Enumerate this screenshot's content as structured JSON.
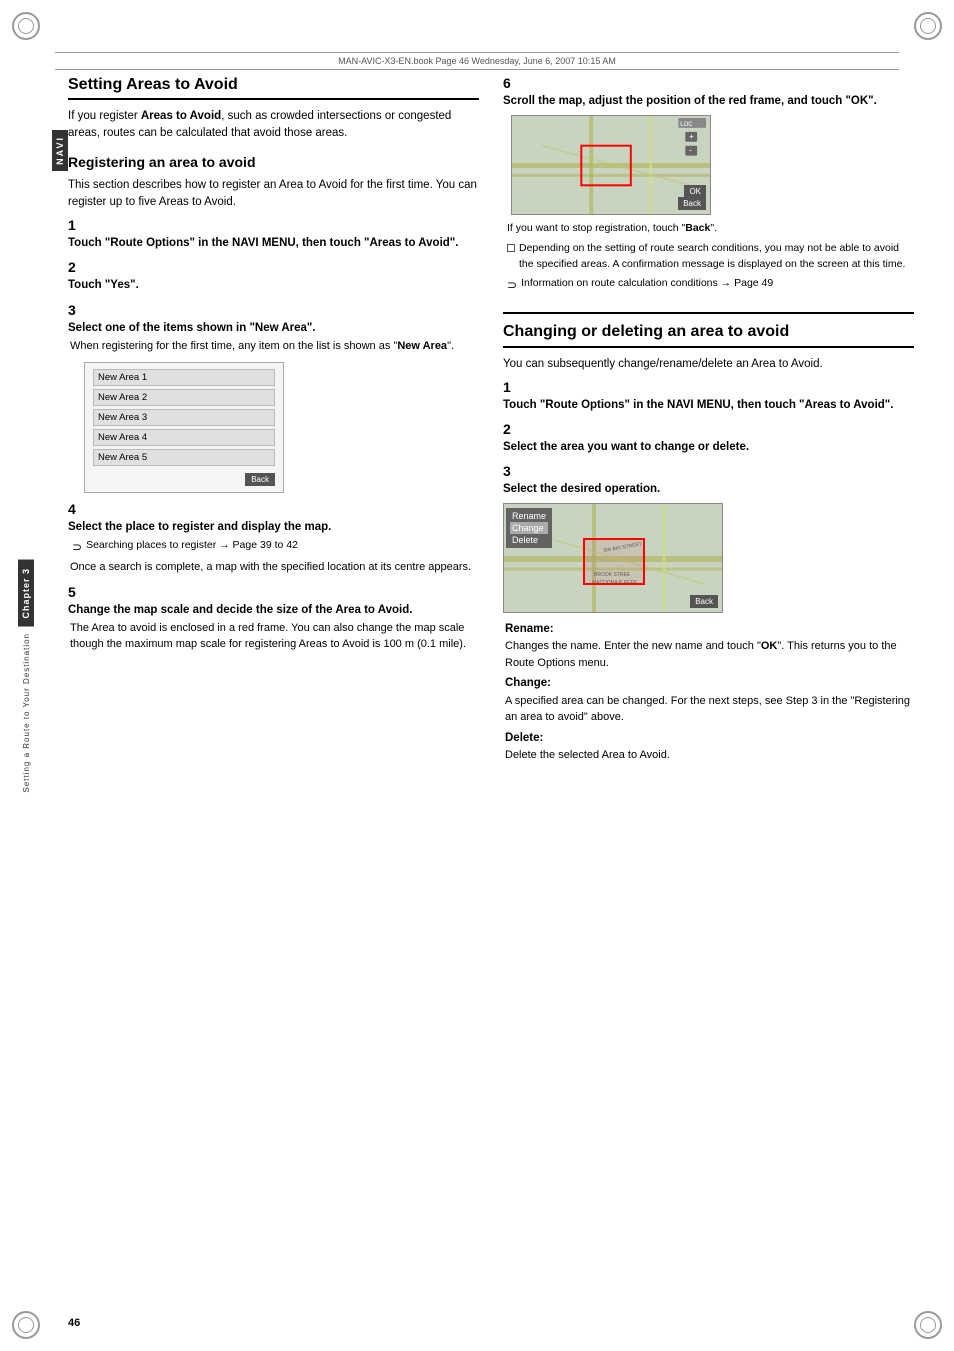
{
  "header": {
    "text": "MAN-AVIC-X3-EN.book  Page 46  Wednesday, June 6, 2007  10:15 AM"
  },
  "sidetab": {
    "label": "NAVI"
  },
  "chapter": {
    "label": "Chapter 3",
    "sublabel": "Setting a Route to Your Destination"
  },
  "page_number": "46",
  "left": {
    "section_title": "Setting Areas to Avoid",
    "section_intro": "If you register Areas to Avoid, such as crowded intersections or congested areas, routes can be calculated that avoid those areas.",
    "subsection_title": "Registering an area to avoid",
    "subsection_intro": "This section describes how to register an Area to Avoid for the first time. You can register up to five Areas to Avoid.",
    "steps": [
      {
        "num": "1",
        "title": "Touch \"Route Options\" in the NAVI MENU, then touch \"Areas to Avoid\"."
      },
      {
        "num": "2",
        "title": "Touch \"Yes\"."
      },
      {
        "num": "3",
        "title": "Select one of the items shown in \"New Area\".",
        "body": "When registering for the first time, any item on the list is shown as \"New Area\"."
      },
      {
        "num": "4",
        "title": "Select the place to register and display the map.",
        "hint": "Searching places to register → Page 39 to 42",
        "hint2": "Once a search is complete, a map with the specified location at its centre appears."
      },
      {
        "num": "5",
        "title": "Change the map scale and decide the size of the Area to Avoid.",
        "body": "The Area to avoid is enclosed in a red frame. You can also change the map scale though the maximum map scale for registering Areas to Avoid is 100 m (0.1 mile)."
      }
    ],
    "area_list": {
      "items": [
        "New Area 1",
        "New Area 2",
        "New Area 3",
        "New Area 4",
        "New Area 5"
      ],
      "back_label": "Back"
    }
  },
  "right": {
    "step6": {
      "num": "6",
      "title": "Scroll the map, adjust the position of the red frame, and touch \"OK\".",
      "hint1": "If you want to stop registration, touch \"Back\".",
      "hint2": "Depending on the setting of route search conditions, you may not be able to avoid the specified areas. A confirmation message is displayed on the screen at this time.",
      "hint3": "Information on route calculation conditions → Page 49"
    },
    "section_title": "Changing or deleting an area to avoid",
    "section_intro": "You can subsequently change/rename/delete an Area to Avoid.",
    "steps": [
      {
        "num": "1",
        "title": "Touch \"Route Options\" in the NAVI MENU, then touch \"Areas to Avoid\"."
      },
      {
        "num": "2",
        "title": "Select the area you want to change or delete."
      },
      {
        "num": "3",
        "title": "Select the desired operation."
      }
    ],
    "operations": [
      {
        "label": "Rename:",
        "body": "Changes the name. Enter the new name and touch \"OK\". This returns you to the Route Options menu."
      },
      {
        "label": "Change:",
        "body": "A specified area can be changed. For the next steps, see Step 3 in the \"Registering an area to avoid\" above."
      },
      {
        "label": "Delete:",
        "body": "Delete the selected Area to Avoid."
      }
    ],
    "map2_menu": [
      "Rename",
      "Change",
      "Delete"
    ],
    "map_back_label": "Back",
    "map_ok_label": "OK"
  }
}
